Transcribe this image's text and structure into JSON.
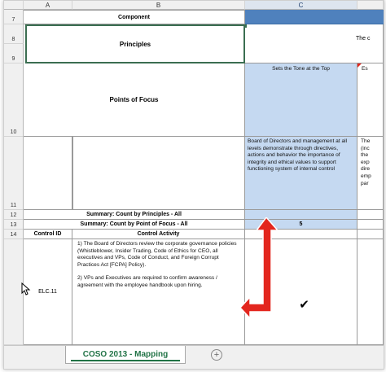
{
  "columns": {
    "a": "A",
    "b": "B",
    "c": "C"
  },
  "rows": {
    "r7": "7",
    "r8": "8",
    "r9": "9",
    "r10": "10",
    "r11": "11",
    "r12": "12",
    "r13": "13",
    "r14": "14"
  },
  "header": {
    "component": "Component",
    "principles": "Principles",
    "principles_partial": "The c",
    "points_of_focus": "Points of Focus"
  },
  "focus": {
    "c_title": "Sets the Tone at the Top",
    "d_title_partial": "Es",
    "c_text": "Board of Directors and management at all levels demonstrate through directives, actions and behavior the importance of integrity and ethical values to support functioning system of internal control",
    "d_text_lines": [
      "The",
      "(inc",
      "the",
      "exp",
      "dire",
      "emp",
      "par"
    ]
  },
  "summary": {
    "by_principles": "Summary: Count by Principles - All",
    "by_point_of_focus": "Summary: Count by Point of Focus - All",
    "count_value": "5"
  },
  "table": {
    "control_id_header": "Control ID",
    "control_activity_header": "Control Activity",
    "control_id": "ELC.11",
    "activity_p1": "1) The Board of Directors review the corporate governance policies (Whistleblower, Insider Trading, Code of Ethics for CEO, all executives and VPs, Code of Conduct, and Foreign Corrupt Practices Act [FCPA] Policy).",
    "activity_p2": "2) VPs and Executives are required to confirm awareness / agreement with the employee handbook upon hiring.",
    "check_mark": "✔"
  },
  "tabs": {
    "active": "COSO 2013 - Mapping",
    "add_label": "+"
  },
  "colors": {
    "accent_blue": "#c5d9f1",
    "header_blue": "#4f81bd",
    "annotation_red": "#e3261e",
    "excel_green": "#217346"
  }
}
